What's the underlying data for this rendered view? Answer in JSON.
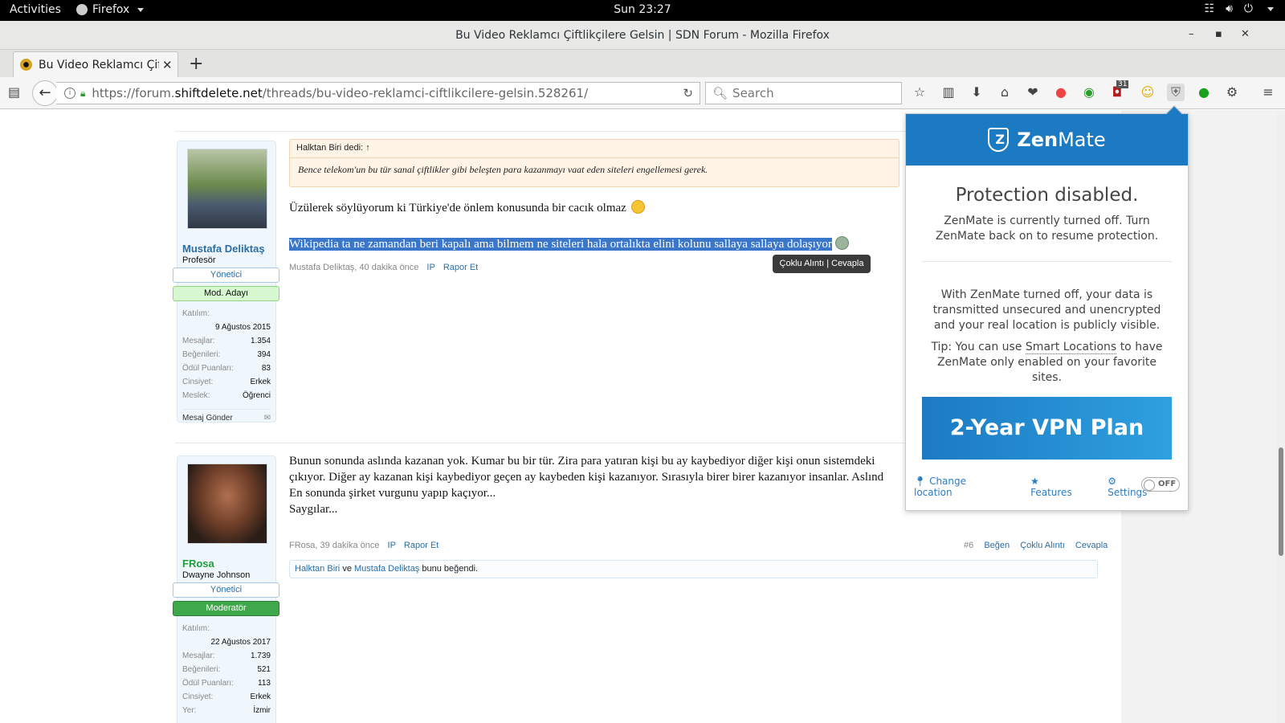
{
  "topbar": {
    "activities": "Activities",
    "app": "Firefox",
    "clock": "Sun 23:27"
  },
  "window": {
    "title": "Bu Video Reklamcı Çiftlikçilere Gelsin | SDN Forum - Mozilla Firefox"
  },
  "tab": {
    "title": "Bu Video Reklamcı Çiftlikçilere Gelsin"
  },
  "url": {
    "prefix": "https://forum.",
    "domain": "shiftdelete.net",
    "path": "/threads/bu-video-reklamci-ciftlikcilere-gelsin.528261/"
  },
  "search": {
    "placeholder": "Search"
  },
  "toolbar": {
    "badge_count": "31"
  },
  "post1": {
    "user": {
      "name": "Mustafa Deliktaş",
      "title": "Profesör",
      "badge1": "Yönetici",
      "badge2": "Mod. Adayı",
      "joined_label": "Katılım:",
      "joined": "9 Ağustos 2015",
      "stats": [
        {
          "k": "Mesajlar:",
          "v": "1.354"
        },
        {
          "k": "Beğenileri:",
          "v": "394"
        },
        {
          "k": "Ödül Puanları:",
          "v": "83"
        },
        {
          "k": "Cinsiyet:",
          "v": "Erkek"
        },
        {
          "k": "Meslek:",
          "v": "Öğrenci"
        }
      ],
      "send": "Mesaj Gönder"
    },
    "quote_head": "Halktan Biri dedi: ↑",
    "quote_body": "Bence telekom'un bu tür sanal çiftlikler gibi beleşten para kazanmayı vaat eden siteleri engellemesi gerek.",
    "line1": "Üzülerek söylüyorum ki Türkiye'de önlem konusunda bir cacık olmaz",
    "line2": "Wikipedia ta ne zamandan beri kapalı ama bilmem ne siteleri hala ortalıkta elini kolunu sallaya sallaya dolaşıyor",
    "meta": "Mustafa Deliktaş, 40 dakika önce",
    "ip": "IP",
    "report": "Rapor Et",
    "tooltip": "Çoklu Alıntı | Cevapla"
  },
  "post2": {
    "user": {
      "name": "FRosa",
      "title": "Dwayne Johnson",
      "badge1": "Yönetici",
      "badge2": "Moderatör",
      "joined_label": "Katılım:",
      "joined": "22 Ağustos 2017",
      "stats": [
        {
          "k": "Mesajlar:",
          "v": "1.739"
        },
        {
          "k": "Beğenileri:",
          "v": "521"
        },
        {
          "k": "Ödül Puanları:",
          "v": "113"
        },
        {
          "k": "Cinsiyet:",
          "v": "Erkek"
        },
        {
          "k": "Yer:",
          "v": "İzmir"
        }
      ]
    },
    "lines": [
      "Bunun sonunda aslında kazanan yok. Kumar bu bir tür. Zira para yatıran kişi bu ay kaybediyor diğer kişi onun sistemdeki",
      "çıkıyor. Diğer ay kazanan kişi kaybediyor geçen ay kaybeden kişi kazanıyor. Sırasıyla birer birer kazanıyor insanlar. Aslınd",
      "En sonunda şirket vurgunu yapıp kaçıyor...",
      "Saygılar..."
    ],
    "meta": "FRosa, 39 dakika önce",
    "ip": "IP",
    "report": "Rapor Et",
    "num": "#6",
    "like": "Beğen",
    "multi": "Çoklu Alıntı",
    "reply": "Cevapla",
    "likes_a": "Halktan Biri",
    "likes_and": "ve",
    "likes_b": "Mustafa Deliktaş",
    "likes_tail": "bunu beğendi."
  },
  "zenmate": {
    "brand_a": "Zen",
    "brand_b": "Mate",
    "title": "Protection disabled.",
    "p1": "ZenMate is currently turned off. Turn ZenMate back on to resume protection.",
    "p2": "With ZenMate turned off, your data is transmitted unsecured and unencrypted and your real location is publicly visible.",
    "p3_a": "Tip: You can use",
    "p3_link": "Smart Locations",
    "p3_b": "to have ZenMate only enabled on your favorite sites.",
    "cta": "2-Year VPN Plan",
    "change_location": "Change location",
    "features": "Features",
    "settings": "Settings",
    "toggle": "OFF",
    "colors": {
      "brand": "#1c7ac3",
      "link": "#2a7cc4"
    }
  }
}
